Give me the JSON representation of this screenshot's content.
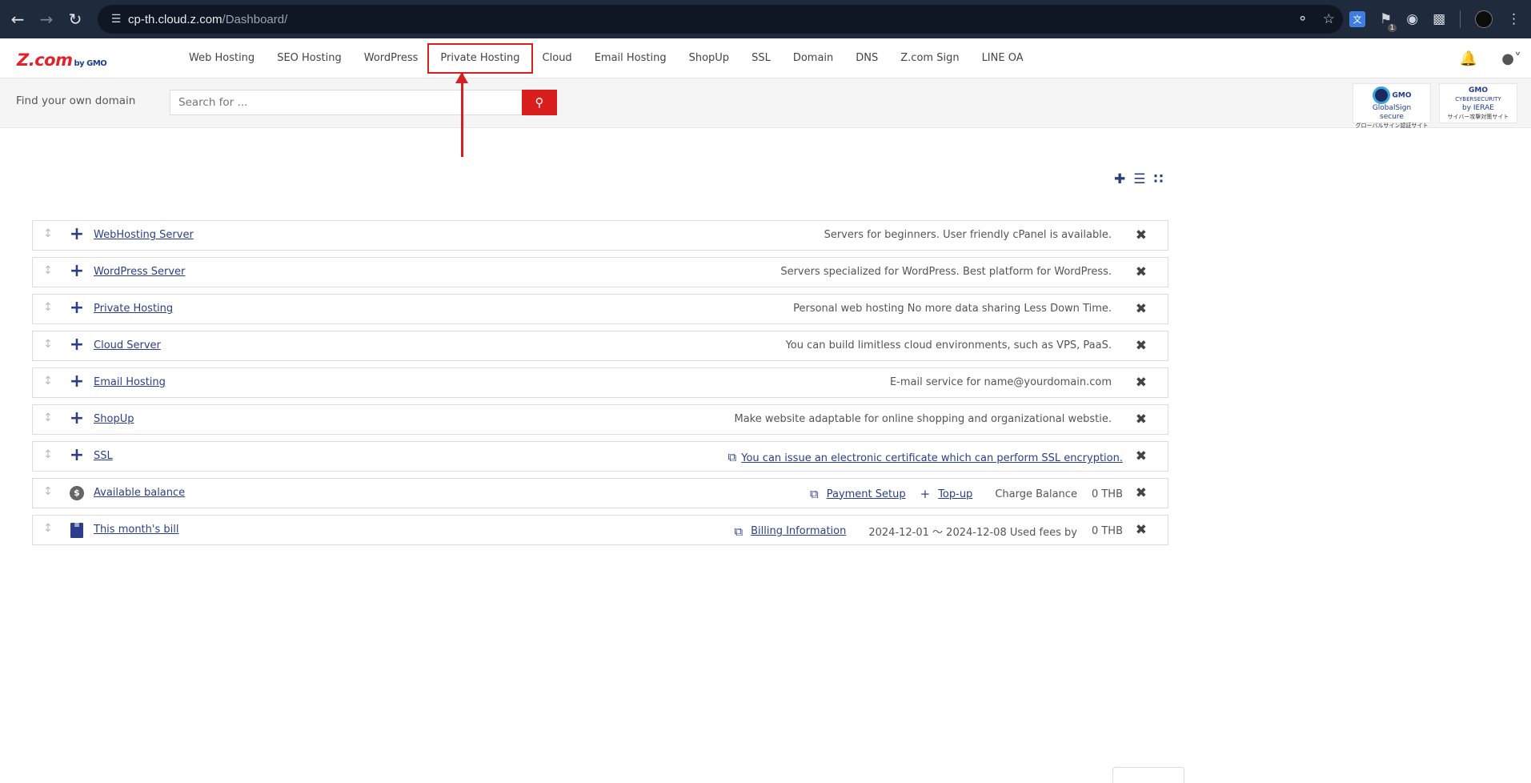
{
  "browser": {
    "url_host": "cp-th.cloud.z.com",
    "url_path": "/Dashboard/",
    "ext_badge": "1"
  },
  "header": {
    "logo": "Z.com",
    "logo_by": "by GMO",
    "nav": [
      {
        "label": "Web Hosting"
      },
      {
        "label": "SEO Hosting"
      },
      {
        "label": "WordPress"
      },
      {
        "label": "Private Hosting"
      },
      {
        "label": "Cloud"
      },
      {
        "label": "Email Hosting"
      },
      {
        "label": "ShopUp"
      },
      {
        "label": "SSL"
      },
      {
        "label": "Domain"
      },
      {
        "label": "DNS"
      },
      {
        "label": "Z.com Sign"
      },
      {
        "label": "LINE OA"
      }
    ]
  },
  "search": {
    "label": "Find your own domain",
    "placeholder": "Search for ..."
  },
  "seals": {
    "globalsign": {
      "line1": "GMO",
      "line2": "GlobalSign",
      "line3": "secure",
      "line4": "グローバルサイン認証サイト"
    },
    "ierae": {
      "line1": "GMO",
      "line2": "CYBERSECURITY",
      "line3": "by IERAE",
      "line4": "サイバー攻撃対策サイト"
    }
  },
  "rows": [
    {
      "title": "WebHosting Server",
      "desc": "Servers for beginners. User friendly cPanel is available."
    },
    {
      "title": "WordPress Server",
      "desc": "Servers specialized for WordPress. Best platform for WordPress."
    },
    {
      "title": "Private Hosting",
      "desc": "Personal web hosting No more data sharing Less Down Time."
    },
    {
      "title": "Cloud Server",
      "desc": "You can build limitless cloud environments, such as VPS, PaaS."
    },
    {
      "title": "Email Hosting",
      "desc": "E-mail service for name@yourdomain.com"
    },
    {
      "title": "ShopUp",
      "desc": "Make website adaptable for online shopping and organizational webstie."
    },
    {
      "title": "SSL",
      "desc": "You can issue an electronic certificate which can perform SSL encryption."
    }
  ],
  "balance": {
    "title": "Available balance",
    "payment_setup": "Payment Setup",
    "topup": "Top-up",
    "charge_label": "Charge Balance",
    "amount": "0 THB"
  },
  "bill": {
    "title": "This month's bill",
    "billing_info": "Billing Information",
    "period": "2024-12-01 〜 2024-12-08 Used fees by",
    "amount": "0 THB"
  }
}
